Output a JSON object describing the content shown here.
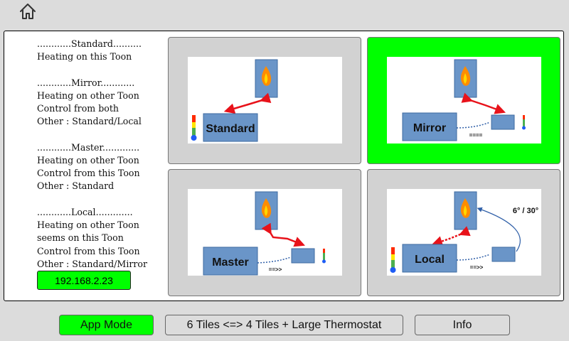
{
  "description": {
    "lines": [
      "............Standard..........",
      "Heating on this Toon",
      "",
      "............Mirror............",
      "Heating on other Toon",
      "Control from both",
      "Other : Standard/Local",
      "",
      "............Master.............",
      "Heating on other Toon",
      "Control from this Toon",
      "Other : Standard",
      "",
      "............Local.............",
      "Heating on other Toon",
      "seems on this Toon",
      "Control from this Toon",
      "Other : Standard/Mirror"
    ]
  },
  "ip_address": "192.168.2.23",
  "tiles": [
    {
      "label": "Standard",
      "active": false
    },
    {
      "label": "Mirror",
      "active": true,
      "sublabel": "===="
    },
    {
      "label": "Master",
      "active": false,
      "sublabel": "==>>"
    },
    {
      "label": "Local",
      "active": false,
      "sublabel": "==>>",
      "note": "6° / 30°"
    }
  ],
  "buttons": {
    "app_mode": "App Mode",
    "tiles_toggle": "6 Tiles <=> 4 Tiles + Large Thermostat",
    "info": "Info"
  },
  "colors": {
    "active_green": "#00ff00",
    "box_blue": "#6a95c8",
    "arrow_red": "#e8121a",
    "link_blue": "#2f5fa8"
  },
  "icons": [
    "home-icon",
    "flame-icon",
    "thermometer-icon"
  ]
}
